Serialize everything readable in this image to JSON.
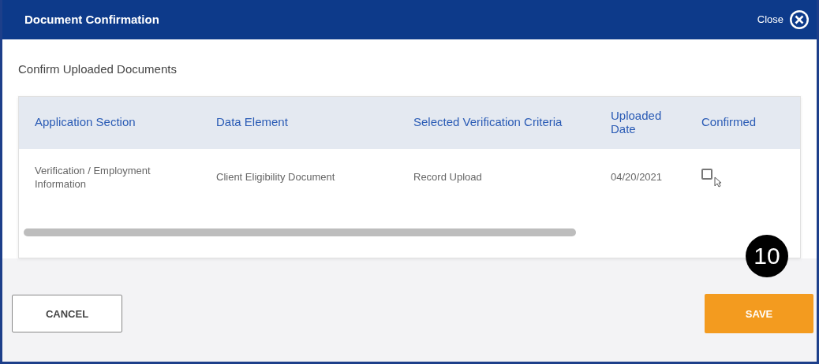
{
  "dialog": {
    "title": "Document Confirmation",
    "close_label": "Close"
  },
  "section_title": "Confirm Uploaded Documents",
  "table": {
    "columns": [
      "Application Section",
      "Data Element",
      "Selected Verification Criteria",
      "Uploaded Date",
      "Confirmed"
    ],
    "rows": [
      {
        "cells": [
          "Verification / Employment Information",
          "Client Eligibility Document",
          "Record Upload",
          "04/20/2021"
        ],
        "confirmed": false
      }
    ]
  },
  "step_badge": "10",
  "buttons": [
    {
      "label": "CANCEL",
      "kind": "secondary"
    },
    {
      "label": "SAVE",
      "kind": "primary"
    }
  ]
}
